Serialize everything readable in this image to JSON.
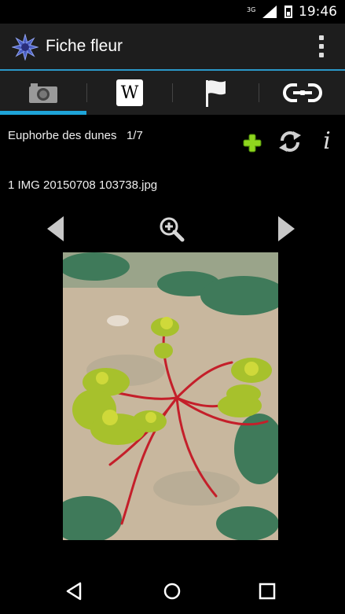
{
  "status_bar": {
    "network": "3G",
    "time": "19:46"
  },
  "app_bar": {
    "logo_icon": "cornflower-logo-icon",
    "title": "Fiche fleur",
    "menu_icon": "overflow-menu-icon"
  },
  "tabs": [
    {
      "icon": "camera-icon",
      "selected": true
    },
    {
      "icon": "wikipedia-icon",
      "label": "W",
      "selected": false
    },
    {
      "icon": "flag-icon",
      "selected": false
    },
    {
      "icon": "link-icon",
      "selected": false
    }
  ],
  "accent_color": "#1ea4d8",
  "plant": {
    "name": "Euphorbe des dunes",
    "counter": "1/7"
  },
  "actions": {
    "add_icon": "plus-icon",
    "refresh_icon": "refresh-icon",
    "info_icon": "info-icon",
    "info_label": "i"
  },
  "image": {
    "filename": "1 IMG 20150708 103738.jpg",
    "prev_icon": "triangle-left-icon",
    "zoom_icon": "zoom-in-icon",
    "next_icon": "triangle-right-icon"
  },
  "nav_bar": {
    "back_icon": "back-icon",
    "home_icon": "home-icon",
    "recents_icon": "recents-icon"
  }
}
